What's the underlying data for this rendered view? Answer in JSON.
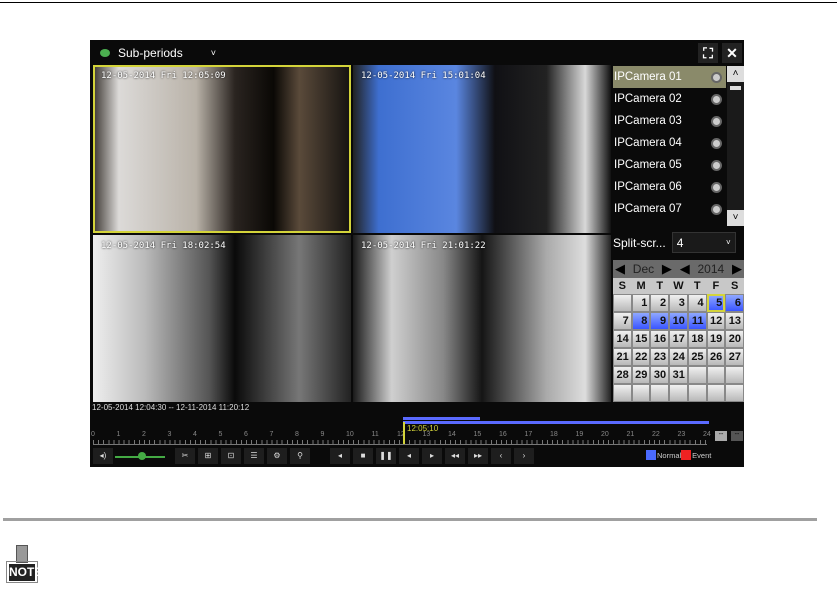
{
  "app": {
    "mode_label": "Sub-periods",
    "fullscreen_icon": "fullscreen-icon",
    "close_icon": "close-icon"
  },
  "tiles": [
    {
      "timestamp": "12-05-2014 Fri 12:05:09",
      "selected": true
    },
    {
      "timestamp": "12-05-2014 Fri 15:01:04",
      "selected": false
    },
    {
      "timestamp": "12-05-2014 Fri 18:02:54",
      "selected": false
    },
    {
      "timestamp": "12-05-2014 Fri 21:01:22",
      "selected": false
    }
  ],
  "cameras": [
    "IPCamera 01",
    "IPCamera 02",
    "IPCamera 03",
    "IPCamera 04",
    "IPCamera 05",
    "IPCamera 06",
    "IPCamera 07"
  ],
  "split": {
    "label": "Split-scr...",
    "value": "4"
  },
  "calendar": {
    "month": "Dec",
    "year": "2014",
    "weekdays": [
      "S",
      "M",
      "T",
      "W",
      "T",
      "F",
      "S"
    ],
    "weeks": [
      [
        "",
        "1",
        "2",
        "3",
        "4",
        "5",
        "6"
      ],
      [
        "7",
        "8",
        "9",
        "10",
        "11",
        "12",
        "13"
      ],
      [
        "14",
        "15",
        "16",
        "17",
        "18",
        "19",
        "20"
      ],
      [
        "21",
        "22",
        "23",
        "24",
        "25",
        "26",
        "27"
      ],
      [
        "28",
        "29",
        "30",
        "31",
        "",
        "",
        ""
      ],
      [
        "",
        "",
        "",
        "",
        "",
        "",
        ""
      ]
    ],
    "selected_day": "5",
    "recorded_days": [
      "6",
      "8",
      "9",
      "10",
      "11"
    ]
  },
  "timeline": {
    "range": "12-05-2014 12:04:30 -- 12-11-2014 11:20:12",
    "current_time": "12:05:10",
    "hours": [
      "0",
      "1",
      "2",
      "3",
      "4",
      "5",
      "6",
      "7",
      "8",
      "9",
      "10",
      "11",
      "12",
      "13",
      "14",
      "15",
      "16",
      "17",
      "18",
      "19",
      "20",
      "21",
      "22",
      "23",
      "24"
    ]
  },
  "legend": {
    "normal": "Normal",
    "event": "Event",
    "normal_color": "#4a6aff",
    "event_color": "#ee2222"
  },
  "note": {
    "label": "NOTE"
  }
}
